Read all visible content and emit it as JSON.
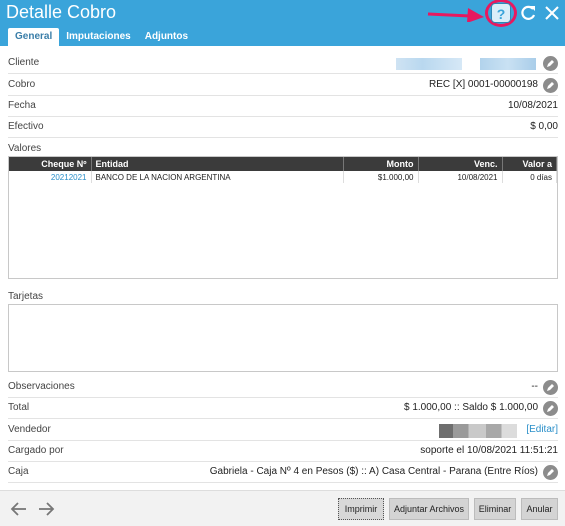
{
  "window": {
    "title": "Detalle Cobro"
  },
  "tabs": [
    {
      "label": "General"
    },
    {
      "label": "Imputaciones"
    },
    {
      "label": "Adjuntos"
    }
  ],
  "header_icons": [
    "arrow-right-icon",
    "help-icon",
    "refresh-icon",
    "close-icon"
  ],
  "header": {
    "help_glyph": "?"
  },
  "fields": {
    "cliente": {
      "label": "Cliente"
    },
    "cobro": {
      "label": "Cobro",
      "value": "REC [X] 0001-00000198"
    },
    "fecha": {
      "label": "Fecha",
      "value": "10/08/2021"
    },
    "efectivo": {
      "label": "Efectivo",
      "value": "$ 0,00"
    }
  },
  "valores": {
    "label": "Valores",
    "columns": [
      "Cheque Nº",
      "Entidad",
      "Monto",
      "Venc.",
      "Valor a"
    ],
    "rows": [
      [
        "20212021",
        "BANCO DE LA NACION ARGENTINA",
        "$1.000,00",
        "10/08/2021",
        "0 días"
      ]
    ]
  },
  "tarjetas": {
    "label": "Tarjetas"
  },
  "bottom_fields": {
    "observaciones": {
      "label": "Observaciones",
      "value": "--"
    },
    "total": {
      "label": "Total",
      "value": "$ 1.000,00 :: Saldo $ 1.000,00"
    },
    "vendedor": {
      "label": "Vendedor",
      "link": "[Editar]"
    },
    "cargado": {
      "label": "Cargado por",
      "value": "soporte el 10/08/2021 11:51:21"
    },
    "caja": {
      "label": "Caja",
      "value": "Gabriela - Caja Nº 4 en Pesos ($) :: A) Casa Central - Parana (Entre Ríos)"
    }
  },
  "footer": {
    "buttons": {
      "imprimir": "Imprimir",
      "adjuntar": "Adjuntar Archivos",
      "eliminar": "Eliminar",
      "anular": "Anular"
    }
  },
  "colors": {
    "header_bg": "#3aa4da",
    "annotation_pink": "#e8185f",
    "link_blue": "#2a8fc9"
  }
}
